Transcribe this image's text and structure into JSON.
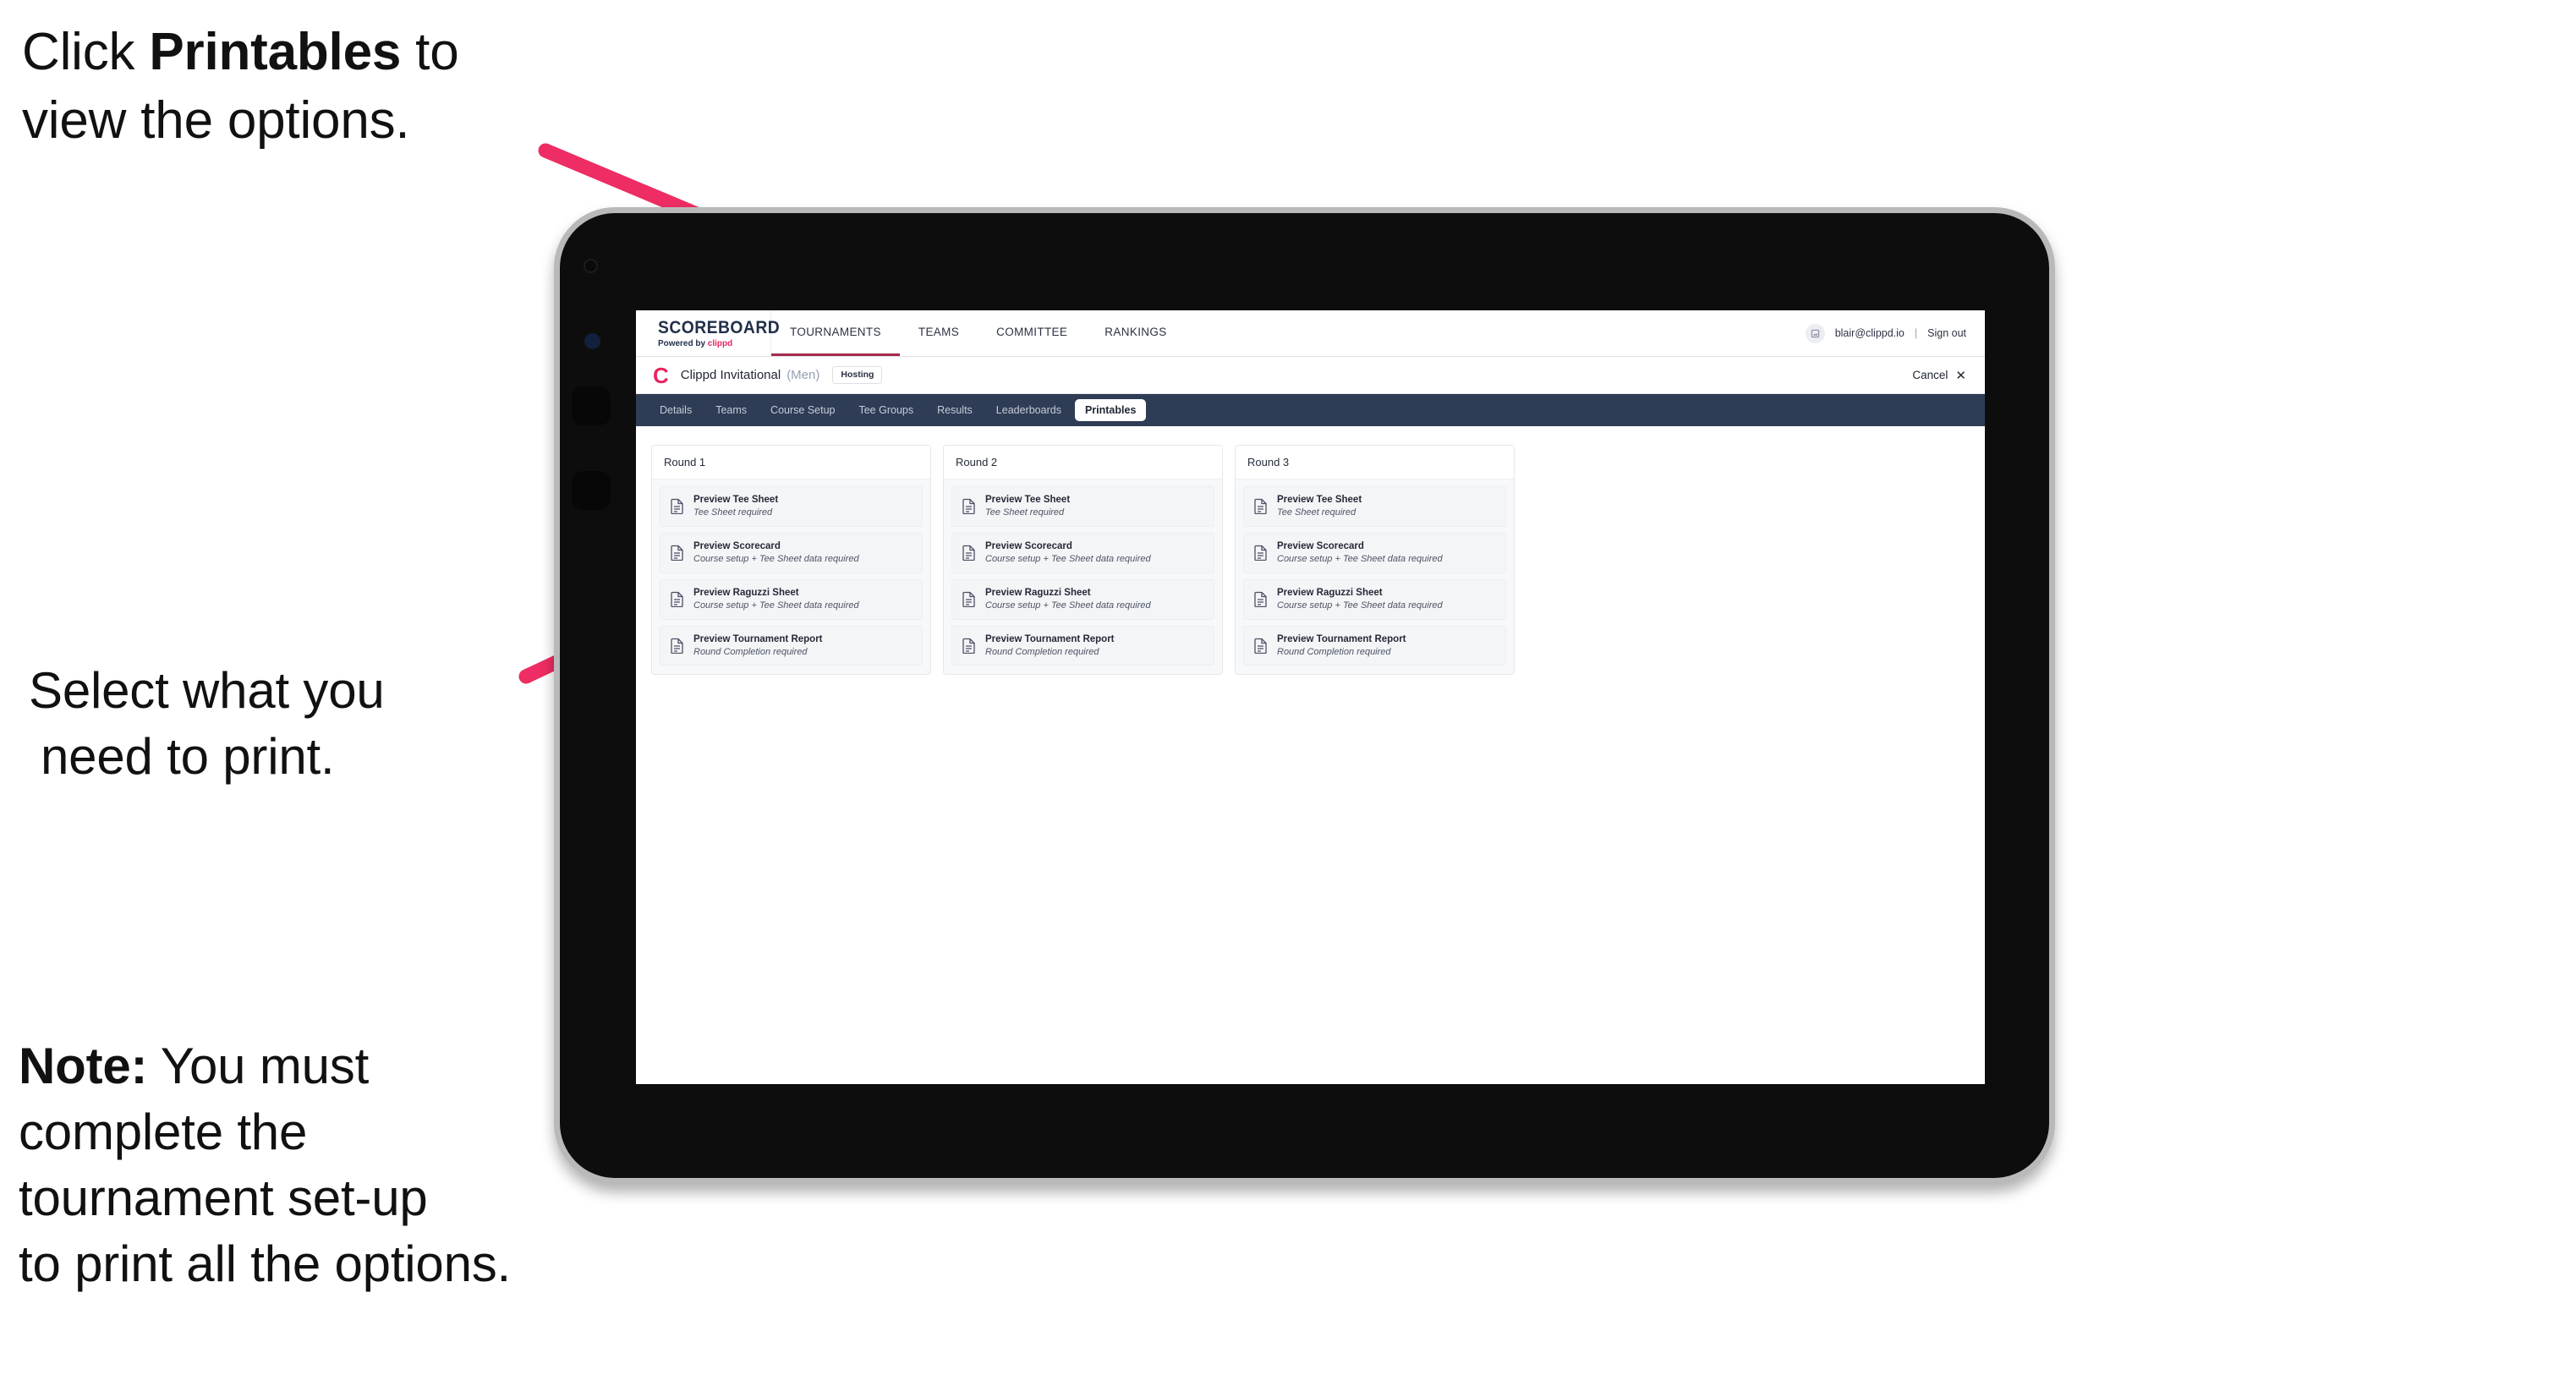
{
  "annotations": {
    "top": {
      "pre": "Click ",
      "bold": "Printables",
      "post": " to\nview the options."
    },
    "middle": {
      "line1": "Select what you",
      "line2": "need to print."
    },
    "note": {
      "bold": "Note:",
      "text": " You must\ncomplete the\ntournament set-up\nto print all the options."
    }
  },
  "colors": {
    "arrow_pink": "#ED2D63",
    "brand_pink": "#E8255F",
    "navy": "#2E3C55",
    "accent_underline": "#A62A4A"
  },
  "app": {
    "logo": {
      "word": "SCOREBOARD",
      "powered_by": "Powered by ",
      "brand": "clippd"
    },
    "top_nav": [
      {
        "label": "TOURNAMENTS",
        "active": true
      },
      {
        "label": "TEAMS",
        "active": false
      },
      {
        "label": "COMMITTEE",
        "active": false
      },
      {
        "label": "RANKINGS",
        "active": false
      }
    ],
    "account": {
      "avatar_icon": "user-avatar-icon",
      "email": "blair@clippd.io",
      "separator": "|",
      "sign_out": "Sign out"
    },
    "tournament_bar": {
      "logo_mark": "C",
      "name": "Clippd Invitational",
      "gender": "(Men)",
      "badge": "Hosting",
      "cancel": "Cancel",
      "cancel_icon": "close-icon"
    },
    "sub_nav": [
      {
        "label": "Details",
        "active": false
      },
      {
        "label": "Teams",
        "active": false
      },
      {
        "label": "Course Setup",
        "active": false
      },
      {
        "label": "Tee Groups",
        "active": false
      },
      {
        "label": "Results",
        "active": false
      },
      {
        "label": "Leaderboards",
        "active": false
      },
      {
        "label": "Printables",
        "active": true
      }
    ],
    "rounds": [
      {
        "title": "Round 1",
        "items": [
          {
            "title": "Preview Tee Sheet",
            "sub": "Tee Sheet required"
          },
          {
            "title": "Preview Scorecard",
            "sub": "Course setup + Tee Sheet data required"
          },
          {
            "title": "Preview Raguzzi Sheet",
            "sub": "Course setup + Tee Sheet data required"
          },
          {
            "title": "Preview Tournament Report",
            "sub": "Round Completion required"
          }
        ]
      },
      {
        "title": "Round 2",
        "items": [
          {
            "title": "Preview Tee Sheet",
            "sub": "Tee Sheet required"
          },
          {
            "title": "Preview Scorecard",
            "sub": "Course setup + Tee Sheet data required"
          },
          {
            "title": "Preview Raguzzi Sheet",
            "sub": "Course setup + Tee Sheet data required"
          },
          {
            "title": "Preview Tournament Report",
            "sub": "Round Completion required"
          }
        ]
      },
      {
        "title": "Round 3",
        "items": [
          {
            "title": "Preview Tee Sheet",
            "sub": "Tee Sheet required"
          },
          {
            "title": "Preview Scorecard",
            "sub": "Course setup + Tee Sheet data required"
          },
          {
            "title": "Preview Raguzzi Sheet",
            "sub": "Course setup + Tee Sheet data required"
          },
          {
            "title": "Preview Tournament Report",
            "sub": "Round Completion required"
          }
        ]
      }
    ]
  }
}
